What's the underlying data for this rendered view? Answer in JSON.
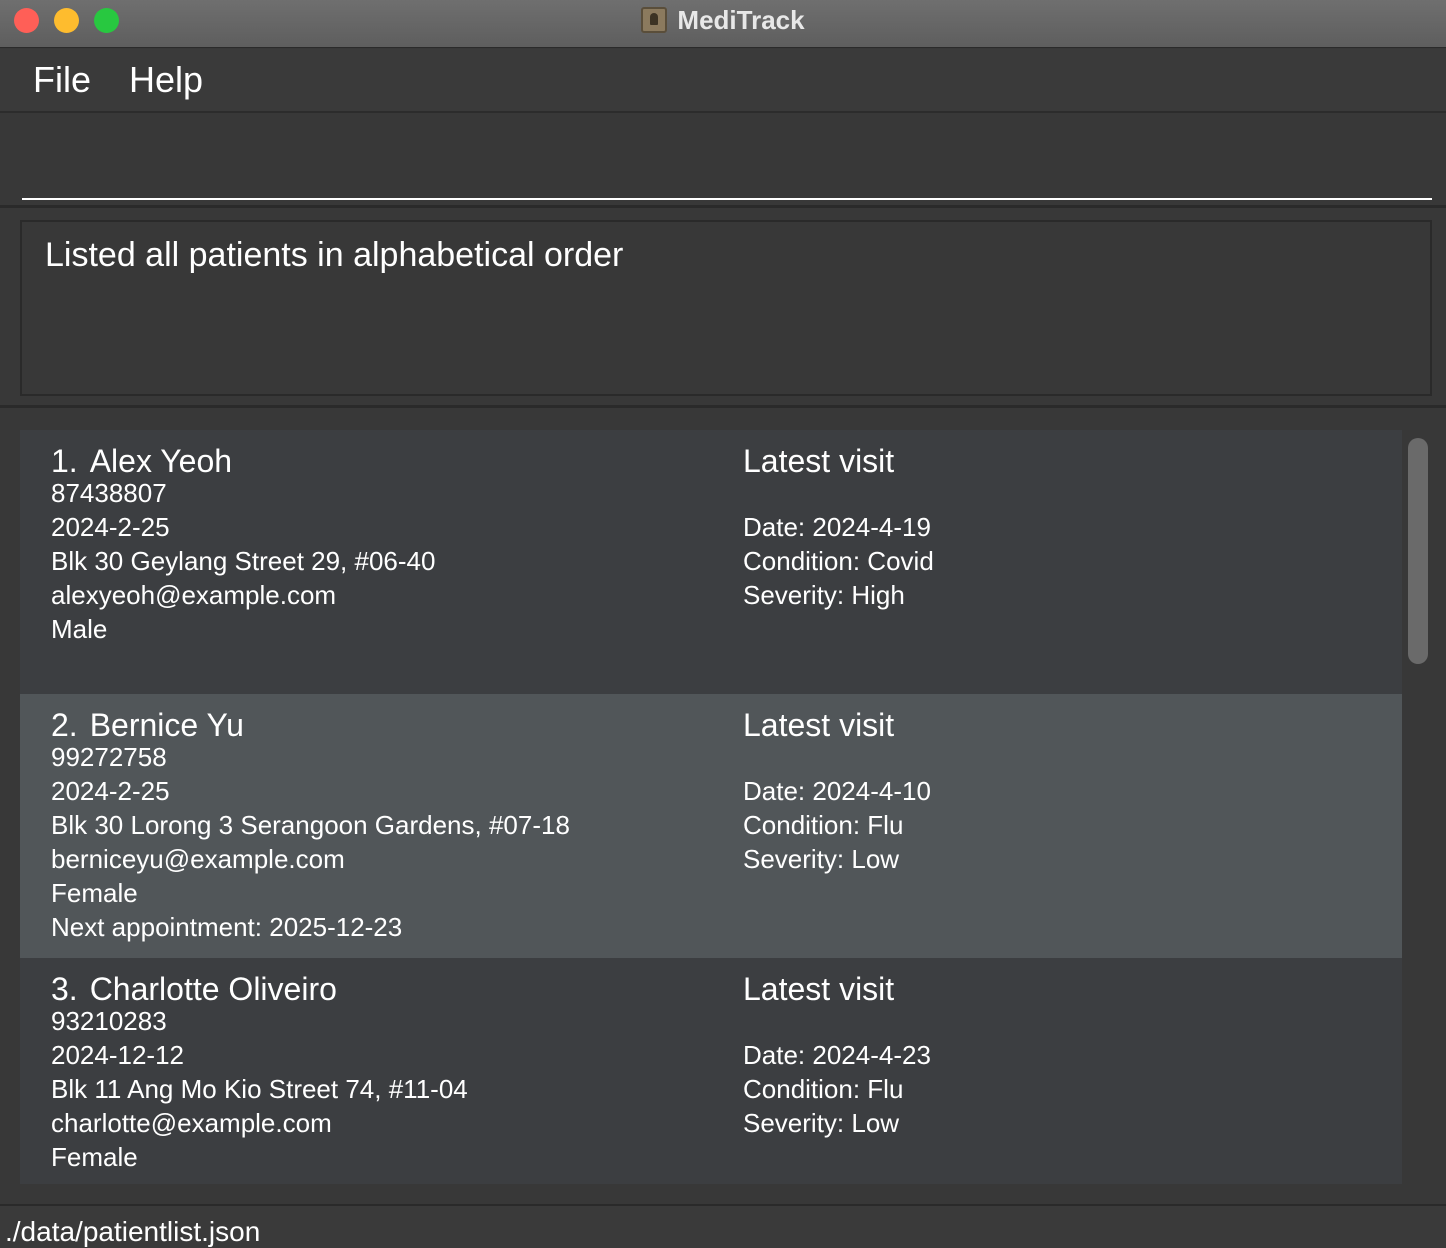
{
  "window": {
    "title": "MediTrack"
  },
  "menu": {
    "file": "File",
    "help": "Help"
  },
  "command": {
    "value": "",
    "placeholder": ""
  },
  "result": {
    "message": "Listed all patients in alphabetical order"
  },
  "patients": [
    {
      "index": "1.",
      "name": "Alex Yeoh",
      "phone": "87438807",
      "date": "2024-2-25",
      "address": "Blk 30 Geylang Street 29, #06-40",
      "email": "alexyeoh@example.com",
      "gender": "Male",
      "next_appointment": "",
      "visit_title": "Latest visit",
      "visit_date": "Date: 2024-4-19",
      "visit_condition": "Condition: Covid",
      "visit_severity": "Severity: High"
    },
    {
      "index": "2.",
      "name": "Bernice Yu",
      "phone": "99272758",
      "date": "2024-2-25",
      "address": "Blk 30 Lorong 3 Serangoon Gardens, #07-18",
      "email": "berniceyu@example.com",
      "gender": "Female",
      "next_appointment": "Next appointment: 2025-12-23",
      "visit_title": "Latest visit",
      "visit_date": "Date: 2024-4-10",
      "visit_condition": "Condition: Flu",
      "visit_severity": "Severity: Low"
    },
    {
      "index": "3.",
      "name": "Charlotte Oliveiro",
      "phone": "93210283",
      "date": "2024-12-12",
      "address": "Blk 11 Ang Mo Kio Street 74, #11-04",
      "email": "charlotte@example.com",
      "gender": "Female",
      "next_appointment": "",
      "visit_title": "Latest visit",
      "visit_date": "Date: 2024-4-23",
      "visit_condition": "Condition: Flu",
      "visit_severity": "Severity: Low"
    }
  ],
  "status": {
    "path": "./data/patientlist.json"
  }
}
